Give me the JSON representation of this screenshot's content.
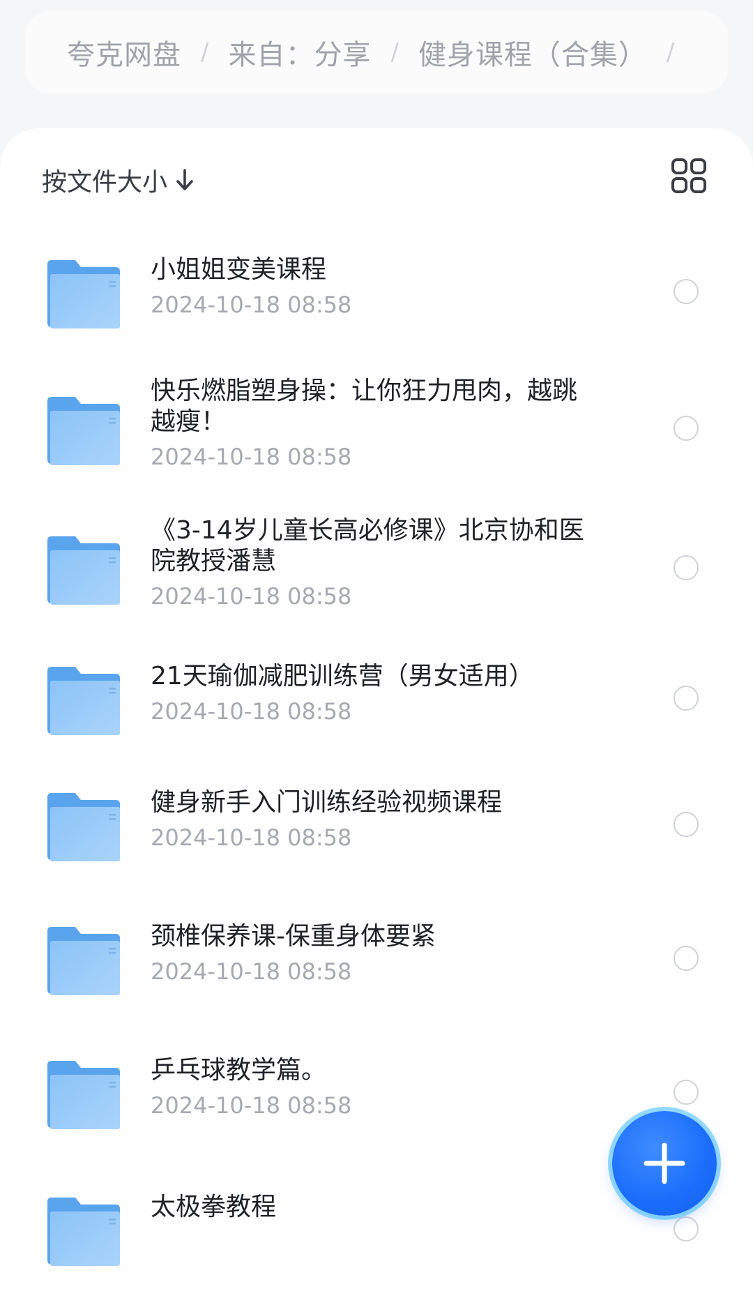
{
  "breadcrumb": {
    "items": [
      "夸克网盘",
      "来自：分享",
      "健身课程（合集）"
    ],
    "separator": "/"
  },
  "toolbar": {
    "sort_label": "按文件大小",
    "sort_icon": "arrow-down-icon",
    "view_icon": "grid-view-icon"
  },
  "files": [
    {
      "name": "小姐姐变美课程",
      "date": "2024-10-18 08:58"
    },
    {
      "name": "快乐燃脂塑身操：让你狂力甩肉，越跳越瘦！",
      "date": "2024-10-18 08:58"
    },
    {
      "name": "《3-14岁儿童长高必修课》北京协和医院教授潘慧",
      "date": "2024-10-18 08:58"
    },
    {
      "name": "21天瑜伽减肥训练营（男女适用）",
      "date": "2024-10-18 08:58"
    },
    {
      "name": "健身新手入门训练经验视频课程",
      "date": "2024-10-18 08:58"
    },
    {
      "name": "颈椎保养课-保重身体要紧",
      "date": "2024-10-18 08:58"
    },
    {
      "name": "乒乓球教学篇。",
      "date": "2024-10-18 08:58"
    },
    {
      "name": "太极拳教程",
      "date": ""
    }
  ],
  "fab": {
    "icon": "plus-icon"
  },
  "colors": {
    "accent": "#1a6dfb",
    "folder": "#7ab8f5",
    "text_primary": "#1f2126",
    "text_secondary": "#a6a9b0"
  }
}
